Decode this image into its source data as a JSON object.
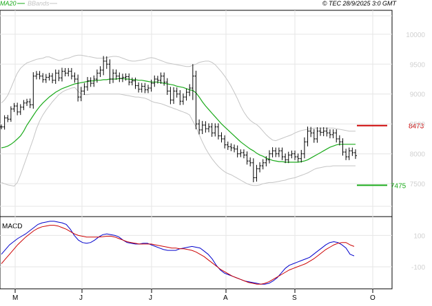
{
  "header": {
    "ma_label": "MA20",
    "bb_label": "BBands",
    "copyright": "© TEC 28/9/2025 3:0 GMT"
  },
  "price_panel": {
    "y_ticks": [
      "10000",
      "9500",
      "9000",
      "8500",
      "8000",
      "7500"
    ],
    "resistance_label": "8473",
    "support_label": "7475"
  },
  "macd_panel": {
    "title": "MACD",
    "y_ticks": [
      "100",
      "-100"
    ]
  },
  "x_labels": [
    "M",
    "J",
    "J",
    "A",
    "S",
    "O"
  ],
  "colors": {
    "price": "#000000",
    "ma20": "#1aaa1a",
    "bbands": "#c4c4c4",
    "resistance": "#cc0000",
    "support": "#1aaa1a",
    "macd": "#0000cc",
    "signal": "#cc0000",
    "grid": "#e6e6e6",
    "panel_bg": "#ffffff",
    "page_bg": "#ffffff"
  },
  "chart_data": [
    {
      "type": "line",
      "subtype": "ohlc-bars",
      "x_categories": [
        "M",
        "J",
        "J",
        "A",
        "S",
        "O"
      ],
      "ylim": [
        6950,
        10400
      ],
      "y_ticks": [
        10000,
        9500,
        9000,
        8500,
        8000,
        7500
      ],
      "grid": true,
      "legend": "top-left",
      "resistance": 8473,
      "support": 7475,
      "price_series": {
        "name": "",
        "values": [
          8450,
          8600,
          8580,
          8750,
          8800,
          8700,
          8780,
          8850,
          8870,
          8820,
          9300,
          9330,
          9300,
          9240,
          9280,
          9300,
          9230,
          9350,
          9270,
          9380,
          9350,
          9380,
          9300,
          9250,
          8950,
          9050,
          9120,
          9220,
          9180,
          9250,
          9350,
          9400,
          9550,
          9500,
          9250,
          9350,
          9300,
          9260,
          9280,
          9290,
          9200,
          9220,
          9140,
          9080,
          9130,
          9070,
          9100,
          9180,
          9250,
          9230,
          9300,
          9200,
          9050,
          8900,
          9050,
          9000,
          8880,
          8950,
          9030,
          9100,
          9300,
          8500,
          8400,
          8480,
          8420,
          8450,
          8350,
          8450,
          8300,
          8250,
          8150,
          8120,
          8100,
          8080,
          8000,
          8020,
          7980,
          7880,
          7850,
          7600,
          7750,
          7800,
          7850,
          7900,
          8000,
          8050,
          8000,
          8050,
          7950,
          7900,
          7980,
          8000,
          7950,
          7920,
          8000,
          8200,
          8380,
          8350,
          8250,
          8380,
          8360,
          8380,
          8350,
          8320,
          8350,
          8250,
          8200,
          8030,
          7950,
          8050,
          8020,
          7970
        ],
        "ohlc_spread": [
          80,
          90,
          100,
          90,
          100,
          110,
          100,
          100,
          100,
          110,
          130,
          110,
          110,
          100,
          110,
          110,
          100,
          120,
          110,
          120,
          110,
          110,
          110,
          120,
          150,
          140,
          130,
          130,
          120,
          120,
          120,
          130,
          170,
          160,
          160,
          130,
          120,
          120,
          120,
          110,
          110,
          110,
          110,
          110,
          110,
          110,
          110,
          120,
          120,
          110,
          120,
          120,
          130,
          140,
          130,
          120,
          130,
          120,
          120,
          130,
          400,
          180,
          150,
          140,
          130,
          120,
          130,
          120,
          120,
          120,
          120,
          110,
          110,
          110,
          120,
          110,
          110,
          120,
          120,
          150,
          130,
          120,
          120,
          120,
          120,
          120,
          110,
          110,
          110,
          110,
          110,
          110,
          110,
          110,
          130,
          150,
          150,
          140,
          130,
          130,
          120,
          130,
          120,
          120,
          120,
          120,
          120,
          120,
          110,
          110,
          110,
          110
        ]
      },
      "ma20_series": {
        "name": "MA20",
        "values": [
          8100,
          8110,
          8130,
          8160,
          8200,
          8250,
          8300,
          8380,
          8480,
          8560,
          8640,
          8720,
          8790,
          8850,
          8900,
          8950,
          8990,
          9030,
          9060,
          9090,
          9110,
          9130,
          9150,
          9170,
          9180,
          9190,
          9200,
          9210,
          9220,
          9220,
          9230,
          9230,
          9240,
          9240,
          9250,
          9250,
          9250,
          9260,
          9260,
          9250,
          9250,
          9240,
          9240,
          9230,
          9230,
          9220,
          9210,
          9200,
          9200,
          9200,
          9190,
          9180,
          9170,
          9160,
          9150,
          9130,
          9120,
          9110,
          9090,
          9070,
          9060,
          9020,
          8950,
          8870,
          8800,
          8740,
          8680,
          8620,
          8560,
          8500,
          8450,
          8400,
          8350,
          8300,
          8250,
          8200,
          8160,
          8120,
          8080,
          8050,
          8010,
          7980,
          7960,
          7930,
          7910,
          7890,
          7880,
          7870,
          7870,
          7860,
          7860,
          7860,
          7860,
          7860,
          7870,
          7880,
          7900,
          7930,
          7960,
          7990,
          8020,
          8050,
          8080,
          8110,
          8130,
          8150,
          8160,
          8160,
          8160,
          8160,
          8160,
          8160
        ]
      },
      "bb_upper": [
        8850,
        8900,
        8980,
        9100,
        9230,
        9350,
        9430,
        9480,
        9520,
        9540,
        9560,
        9580,
        9590,
        9600,
        9620,
        9620,
        9600,
        9580,
        9560,
        9570,
        9590,
        9600,
        9620,
        9640,
        9650,
        9650,
        9640,
        9630,
        9620,
        9610,
        9600,
        9600,
        9600,
        9610,
        9620,
        9630,
        9630,
        9620,
        9600,
        9580,
        9560,
        9550,
        9550,
        9560,
        9570,
        9580,
        9600,
        9610,
        9600,
        9580,
        9560,
        9540,
        9520,
        9510,
        9500,
        9490,
        9480,
        9470,
        9460,
        9460,
        9480,
        9500,
        9530,
        9540,
        9550,
        9550,
        9530,
        9490,
        9430,
        9370,
        9300,
        9220,
        9130,
        9030,
        8920,
        8800,
        8700,
        8620,
        8560,
        8520,
        8490,
        8440,
        8380,
        8320,
        8270,
        8230,
        8220,
        8240,
        8260,
        8280,
        8300,
        8320,
        8350,
        8370,
        8390,
        8400,
        8410,
        8420,
        8430,
        8430,
        8430,
        8430,
        8430,
        8430,
        8430,
        8420,
        8410,
        8400,
        8390,
        8380,
        8380,
        8380
      ],
      "bb_lower": [
        7520,
        7500,
        7480,
        7470,
        7460,
        7520,
        7650,
        7800,
        7950,
        8100,
        8250,
        8420,
        8550,
        8650,
        8730,
        8800,
        8870,
        8930,
        8990,
        9030,
        9060,
        9080,
        9100,
        9110,
        9050,
        9000,
        8990,
        8990,
        9000,
        9000,
        9000,
        9000,
        9000,
        9000,
        9000,
        9000,
        9000,
        9000,
        8990,
        8980,
        8970,
        8960,
        8950,
        8950,
        8940,
        8930,
        8910,
        8880,
        8860,
        8850,
        8840,
        8820,
        8800,
        8780,
        8760,
        8740,
        8720,
        8700,
        8680,
        8650,
        8550,
        8450,
        8320,
        8200,
        8090,
        8000,
        7920,
        7850,
        7790,
        7740,
        7700,
        7670,
        7650,
        7620,
        7590,
        7560,
        7530,
        7500,
        7480,
        7470,
        7470,
        7480,
        7500,
        7510,
        7520,
        7520,
        7530,
        7540,
        7550,
        7560,
        7580,
        7590,
        7600,
        7620,
        7640,
        7660,
        7680,
        7710,
        7740,
        7760,
        7770,
        7780,
        7790,
        7790,
        7800,
        7800,
        7800,
        7800,
        7800,
        7800,
        7800,
        7800
      ]
    },
    {
      "type": "line",
      "title": "MACD",
      "ylim": [
        -240,
        220
      ],
      "y_ticks": [
        100,
        -100
      ],
      "grid": true,
      "series": [
        {
          "name": "",
          "color": "#0000cc",
          "values": [
            -20,
            10,
            40,
            60,
            80,
            95,
            110,
            130,
            150,
            170,
            180,
            185,
            190,
            190,
            185,
            180,
            170,
            140,
            100,
            70,
            55,
            50,
            55,
            70,
            90,
            105,
            110,
            105,
            100,
            90,
            70,
            55,
            50,
            45,
            45,
            50,
            50,
            40,
            30,
            20,
            10,
            5,
            5,
            5,
            15,
            20,
            25,
            30,
            25,
            20,
            0,
            -20,
            -50,
            -90,
            -120,
            -140,
            -150,
            -160,
            -170,
            -180,
            -190,
            -195,
            -200,
            -205,
            -210,
            -210,
            -205,
            -190,
            -170,
            -140,
            -110,
            -90,
            -80,
            -70,
            -60,
            -50,
            -40,
            -20,
            0,
            20,
            40,
            55,
            60,
            55,
            40,
            20,
            -20,
            -30
          ],
          "x_step": 1
        },
        {
          "name": "",
          "color": "#cc0000",
          "values": [
            -80,
            -50,
            -20,
            10,
            40,
            65,
            90,
            110,
            130,
            145,
            155,
            160,
            165,
            165,
            160,
            150,
            140,
            125,
            110,
            100,
            95,
            90,
            90,
            90,
            90,
            92,
            95,
            95,
            90,
            80,
            70,
            60,
            55,
            50,
            45,
            45,
            45,
            45,
            40,
            35,
            30,
            25,
            20,
            20,
            15,
            15,
            10,
            5,
            -5,
            -20,
            -35,
            -55,
            -75,
            -95,
            -115,
            -130,
            -145,
            -160,
            -170,
            -180,
            -190,
            -200,
            -205,
            -210,
            -210,
            -205,
            -195,
            -180,
            -165,
            -150,
            -135,
            -120,
            -110,
            -100,
            -90,
            -80,
            -65,
            -50,
            -30,
            -10,
            10,
            25,
            40,
            50,
            55,
            55,
            40,
            30
          ],
          "x_step": 1
        }
      ]
    }
  ]
}
